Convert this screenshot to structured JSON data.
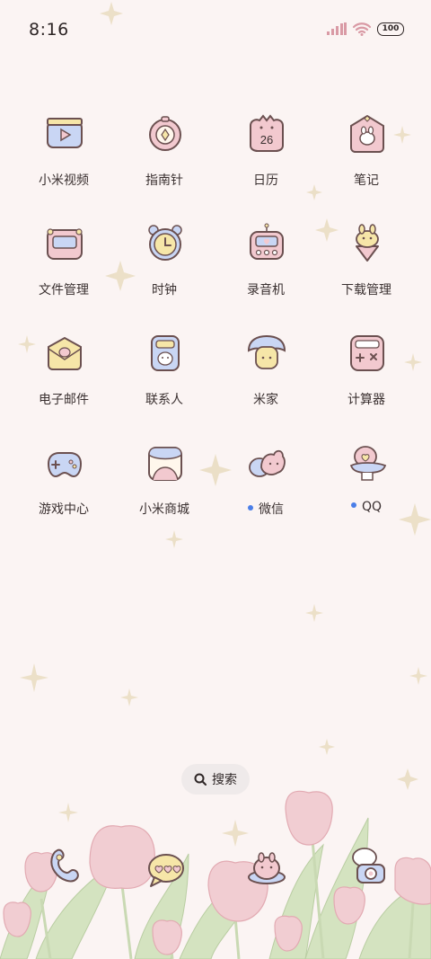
{
  "status_bar": {
    "time": "8:16",
    "battery": "100"
  },
  "apps": [
    {
      "label": "小米视频",
      "icon": "video-icon"
    },
    {
      "label": "指南针",
      "icon": "compass-icon"
    },
    {
      "label": "日历",
      "icon": "calendar-icon",
      "date": "26"
    },
    {
      "label": "笔记",
      "icon": "notes-icon"
    },
    {
      "label": "文件管理",
      "icon": "file-manager-icon"
    },
    {
      "label": "时钟",
      "icon": "clock-icon"
    },
    {
      "label": "录音机",
      "icon": "recorder-icon"
    },
    {
      "label": "下载管理",
      "icon": "download-icon"
    },
    {
      "label": "电子邮件",
      "icon": "email-icon"
    },
    {
      "label": "联系人",
      "icon": "contacts-icon"
    },
    {
      "label": "米家",
      "icon": "mijia-icon"
    },
    {
      "label": "计算器",
      "icon": "calculator-icon"
    },
    {
      "label": "游戏中心",
      "icon": "game-center-icon"
    },
    {
      "label": "小米商城",
      "icon": "mi-store-icon"
    },
    {
      "label": "微信",
      "icon": "wechat-icon",
      "new": true
    },
    {
      "label": "QQ",
      "icon": "qq-icon",
      "new": true
    }
  ],
  "search": {
    "label": "搜索"
  },
  "dock": [
    {
      "icon": "phone-icon"
    },
    {
      "icon": "messages-icon"
    },
    {
      "icon": "browser-icon"
    },
    {
      "icon": "camera-icon"
    }
  ],
  "colors": {
    "background": "#fbf4f3",
    "outline": "#6b5050",
    "pink": "#f2c9cf",
    "blue": "#c9d6f4",
    "yellow": "#f6e6a8",
    "new_dot": "#4a7ee8"
  }
}
